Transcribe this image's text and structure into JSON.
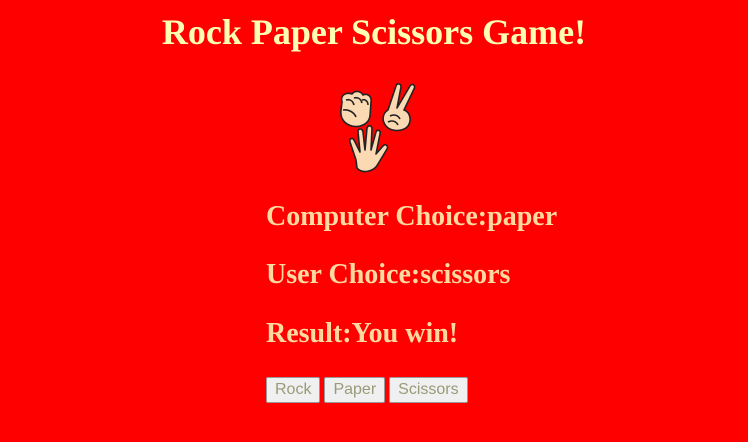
{
  "page": {
    "title": "Rock Paper Scissors Game!",
    "background_color": "#ff0000",
    "title_color": "#ffffb3",
    "text_color": "#ffd9a0"
  },
  "illustration": {
    "icon": "rock-paper-scissors-hands-icon"
  },
  "game": {
    "computer_choice_label": "Computer Choice:",
    "computer_choice": "paper",
    "user_choice_label": "User Choice:",
    "user_choice": "scissors",
    "result_label": "Result:",
    "result": "You win!"
  },
  "controls": {
    "rock_label": "Rock",
    "paper_label": "Paper",
    "scissors_label": "Scissors"
  }
}
